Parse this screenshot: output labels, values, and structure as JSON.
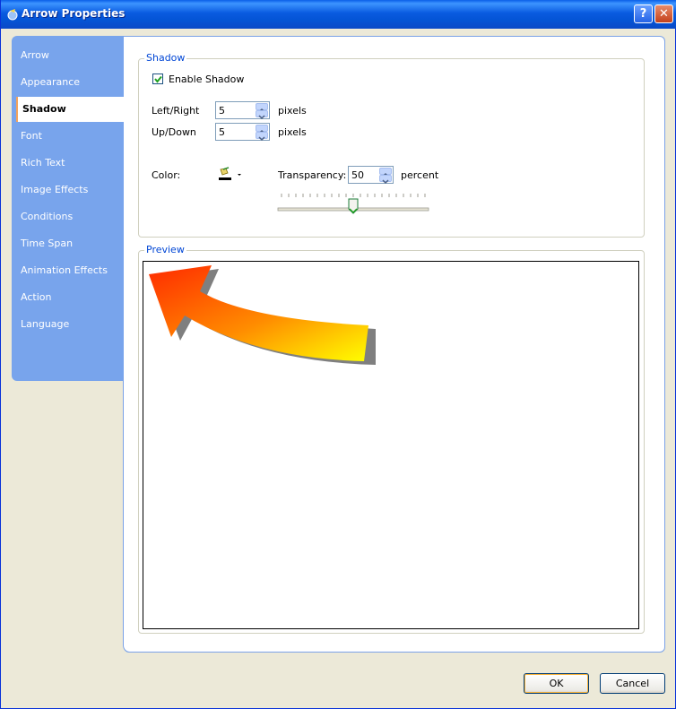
{
  "window": {
    "title": "Arrow Properties",
    "help_label": "?",
    "close_label": "✕"
  },
  "sidebar": {
    "items": [
      {
        "label": "Arrow",
        "active": false
      },
      {
        "label": "Appearance",
        "active": false
      },
      {
        "label": "Shadow",
        "active": true
      },
      {
        "label": "Font",
        "active": false
      },
      {
        "label": "Rich Text",
        "active": false
      },
      {
        "label": "Image Effects",
        "active": false
      },
      {
        "label": "Conditions",
        "active": false
      },
      {
        "label": "Time Span",
        "active": false
      },
      {
        "label": "Animation Effects",
        "active": false
      },
      {
        "label": "Action",
        "active": false
      },
      {
        "label": "Language",
        "active": false
      }
    ]
  },
  "shadow": {
    "group_label": "Shadow",
    "enable_label": "Enable Shadow",
    "enabled": true,
    "left_right_label": "Left/Right",
    "left_right_value": "5",
    "up_down_label": "Up/Down",
    "up_down_value": "5",
    "pixels_label": "pixels",
    "color_label": "Color:",
    "transparency_label": "Transparency:",
    "transparency_value": "50",
    "percent_label": "percent",
    "slider_level": 0.5
  },
  "preview": {
    "group_label": "Preview"
  },
  "footer": {
    "ok_label": "OK",
    "cancel_label": "Cancel"
  },
  "colors": {
    "titlebar": "#0a5be0",
    "sidebar": "#78a4ec",
    "arrow_gradient_start": "#ff2a00",
    "arrow_gradient_end": "#ffff00",
    "shadow": "#7f7f7f"
  }
}
